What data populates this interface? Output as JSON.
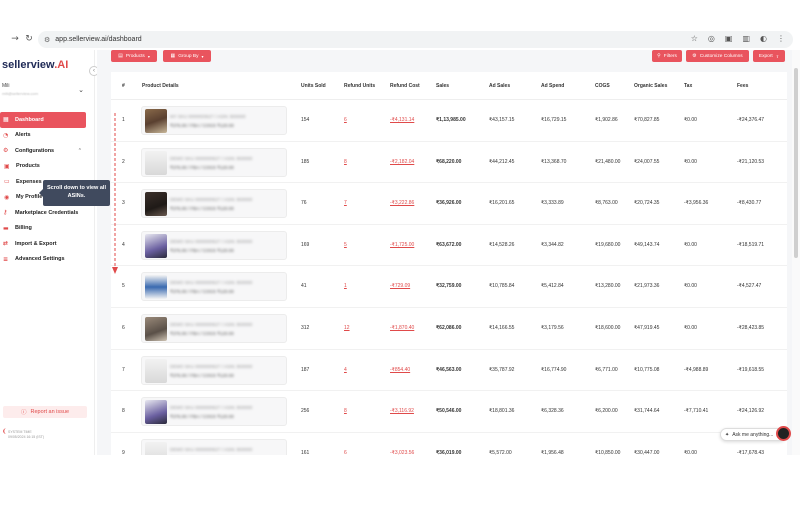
{
  "browser": {
    "url": "app.sellerview.ai/dashboard"
  },
  "sidebar": {
    "logo_main": "sellerview",
    "logo_accent": ".AI",
    "user_name": "Mili",
    "user_email": "mili@sellerview.com",
    "items": [
      {
        "label": "Dashboard",
        "icon": "grid-icon",
        "active": true
      },
      {
        "label": "Alerts",
        "icon": "bell-icon"
      },
      {
        "label": "Configurations",
        "icon": "gear-icon",
        "expanded": true
      },
      {
        "label": "Products",
        "icon": "box-icon",
        "sub": true
      },
      {
        "label": "Expenses",
        "icon": "wallet-icon",
        "sub": true
      },
      {
        "label": "My Profile",
        "icon": "user-icon",
        "sub": true
      },
      {
        "label": "Marketplace Credentials",
        "icon": "key-icon"
      },
      {
        "label": "Billing",
        "icon": "card-icon"
      },
      {
        "label": "Import & Export",
        "icon": "swap-icon"
      },
      {
        "label": "Advanced Settings",
        "icon": "sliders-icon"
      }
    ],
    "tooltip": "Scroll down to view all ASINs.",
    "report": "Report an issue",
    "system_time_label": "SYSTEM TIME",
    "system_time_value": "09/05/2024 16:15 (IST)"
  },
  "toolbar": {
    "products": "Products",
    "group_by": "Group By",
    "filters": "Filters",
    "customize": "Customize Columns",
    "export": "Export"
  },
  "table": {
    "columns": [
      "#",
      "Product Details",
      "Units Sold",
      "Refund Units",
      "Refund Cost",
      "Sales",
      "Ad Sales",
      "Ad Spend",
      "COGS",
      "Organic Sales",
      "Tax",
      "Fees"
    ],
    "rows": [
      {
        "n": "1",
        "sku": "MY SKU 0000000627 / ASIN: B00000",
        "price": "₹376.00 / FBA / COGS ₹120.00",
        "units": "154",
        "ref_units": "6",
        "ref_cost": "-₹4,131.14",
        "sales": "₹1,13,985.00",
        "ad_sales": "₹43,157.15",
        "ad_spend": "₹16,729.15",
        "cogs": "₹1,902.86",
        "organic": "₹70,827.85",
        "tax": "₹0.00",
        "fees": "-₹24,376.47"
      },
      {
        "n": "2",
        "sku": "DEMO SKU 0000000627 / ASIN: B00000",
        "price": "₹376.00 / FBA / COGS ₹120.00",
        "units": "185",
        "ref_units": "8",
        "ref_cost": "-₹2,182.04",
        "sales": "₹68,220.00",
        "ad_sales": "₹44,212.45",
        "ad_spend": "₹13,368.70",
        "cogs": "₹21,480.00",
        "organic": "₹24,007.55",
        "tax": "₹0.00",
        "fees": "-₹21,120.53"
      },
      {
        "n": "3",
        "sku": "DEMO SKU 0000000627 / ASIN: B00000",
        "price": "₹376.00 / FBA / COGS ₹120.00",
        "units": "76",
        "ref_units": "7",
        "ref_cost": "-₹3,222.86",
        "sales": "₹36,926.00",
        "ad_sales": "₹16,201.65",
        "ad_spend": "₹3,333.89",
        "cogs": "₹8,763.00",
        "organic": "₹20,724.35",
        "tax": "-₹3,956.36",
        "fees": "-₹8,430.77"
      },
      {
        "n": "4",
        "sku": "DEMO SKU 0000000627 / ASIN: B00000",
        "price": "₹376.00 / FBA / COGS ₹120.00",
        "units": "169",
        "ref_units": "5",
        "ref_cost": "-₹1,725.00",
        "sales": "₹63,672.00",
        "ad_sales": "₹14,528.26",
        "ad_spend": "₹3,344.82",
        "cogs": "₹19,680.00",
        "organic": "₹49,143.74",
        "tax": "₹0.00",
        "fees": "-₹18,519.71"
      },
      {
        "n": "5",
        "sku": "DEMO SKU 0000000627 / ASIN: B00000",
        "price": "₹376.00 / FBA / COGS ₹120.00",
        "units": "41",
        "ref_units": "1",
        "ref_cost": "-₹729.09",
        "sales": "₹32,759.00",
        "ad_sales": "₹10,785.84",
        "ad_spend": "₹5,412.84",
        "cogs": "₹13,280.00",
        "organic": "₹21,973.36",
        "tax": "₹0.00",
        "fees": "-₹4,527.47"
      },
      {
        "n": "6",
        "sku": "DEMO SKU 0000000627 / ASIN: B00000",
        "price": "₹376.00 / FBA / COGS ₹120.00",
        "units": "312",
        "ref_units": "12",
        "ref_cost": "-₹1,870.40",
        "sales": "₹62,086.00",
        "ad_sales": "₹14,166.55",
        "ad_spend": "₹3,179.56",
        "cogs": "₹18,600.00",
        "organic": "₹47,919.45",
        "tax": "₹0.00",
        "fees": "-₹28,423.85"
      },
      {
        "n": "7",
        "sku": "DEMO SKU 0000000627 / ASIN: B00000",
        "price": "₹376.00 / FBA / COGS ₹120.00",
        "units": "187",
        "ref_units": "4",
        "ref_cost": "-₹854.40",
        "sales": "₹46,563.00",
        "ad_sales": "₹35,787.92",
        "ad_spend": "₹16,774.90",
        "cogs": "₹6,771.00",
        "organic": "₹10,775.08",
        "tax": "-₹4,988.89",
        "fees": "-₹19,618.55"
      },
      {
        "n": "8",
        "sku": "DEMO SKU 0000000627 / ASIN: B00000",
        "price": "₹376.00 / FBA / COGS ₹120.00",
        "units": "256",
        "ref_units": "8",
        "ref_cost": "-₹3,116.92",
        "sales": "₹50,546.00",
        "ad_sales": "₹18,801.36",
        "ad_spend": "₹6,328.36",
        "cogs": "₹6,200.00",
        "organic": "₹31,744.64",
        "tax": "-₹7,710.41",
        "fees": "-₹24,126.92"
      },
      {
        "n": "9",
        "sku": "DEMO SKU 0000000627 / ASIN: B00000",
        "price": "₹376.00 / FBA / COGS ₹120.00",
        "units": "161",
        "ref_units": "6",
        "ref_cost": "-₹3,023.56",
        "sales": "₹36,019.00",
        "ad_sales": "₹5,572.00",
        "ad_spend": "₹1,956.48",
        "cogs": "₹10,850.00",
        "organic": "₹30,447.00",
        "tax": "₹0.00",
        "fees": "-₹17,678.43"
      }
    ]
  },
  "chat": {
    "label": "Ask me anything..."
  },
  "colors": {
    "accent": "#e9545e",
    "navy": "#1f2a56",
    "tooltip_bg": "#404a5e"
  }
}
